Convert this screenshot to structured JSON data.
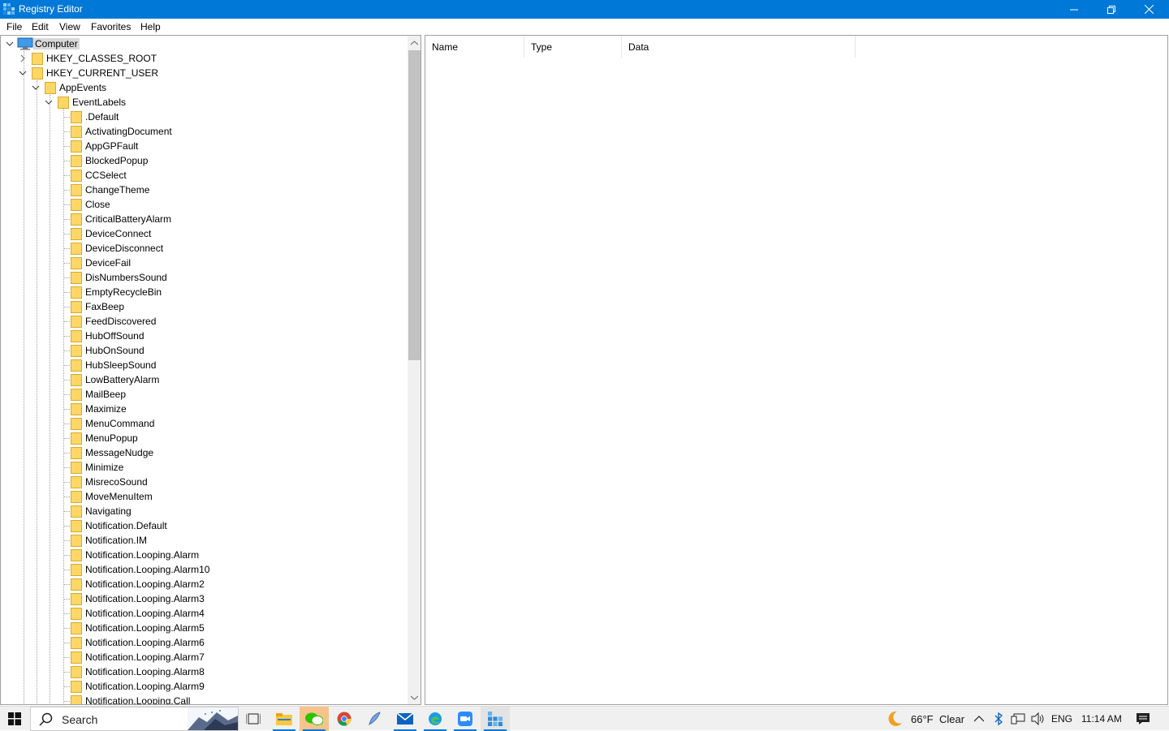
{
  "window": {
    "title": "Registry Editor"
  },
  "menu": [
    "File",
    "Edit",
    "View",
    "Favorites",
    "Help"
  ],
  "tree": {
    "root": "Computer",
    "hives": [
      "HKEY_CLASSES_ROOT",
      "HKEY_CURRENT_USER"
    ],
    "appevents": "AppEvents",
    "eventlabels": "EventLabels",
    "children": [
      ".Default",
      "ActivatingDocument",
      "AppGPFault",
      "BlockedPopup",
      "CCSelect",
      "ChangeTheme",
      "Close",
      "CriticalBatteryAlarm",
      "DeviceConnect",
      "DeviceDisconnect",
      "DeviceFail",
      "DisNumbersSound",
      "EmptyRecycleBin",
      "FaxBeep",
      "FeedDiscovered",
      "HubOffSound",
      "HubOnSound",
      "HubSleepSound",
      "LowBatteryAlarm",
      "MailBeep",
      "Maximize",
      "MenuCommand",
      "MenuPopup",
      "MessageNudge",
      "Minimize",
      "MisrecoSound",
      "MoveMenuItem",
      "Navigating",
      "Notification.Default",
      "Notification.IM",
      "Notification.Looping.Alarm",
      "Notification.Looping.Alarm10",
      "Notification.Looping.Alarm2",
      "Notification.Looping.Alarm3",
      "Notification.Looping.Alarm4",
      "Notification.Looping.Alarm5",
      "Notification.Looping.Alarm6",
      "Notification.Looping.Alarm7",
      "Notification.Looping.Alarm8",
      "Notification.Looping.Alarm9",
      "Notification.Looping.Call"
    ]
  },
  "list": {
    "columns": [
      "Name",
      "Type",
      "Data"
    ]
  },
  "taskbar": {
    "search_label": "Search",
    "apps": [
      "task-view",
      "file-explorer",
      "wechat",
      "chrome",
      "feather-app",
      "mail",
      "edge",
      "zoom",
      "registry-editor"
    ],
    "weather_temp": "66°F",
    "weather_cond": "Clear",
    "lang": "ENG",
    "time": "11:14 AM"
  },
  "colors": {
    "titlebar": "#0078d7",
    "folder": "#ffd766",
    "selection": "#d9d9d9"
  }
}
